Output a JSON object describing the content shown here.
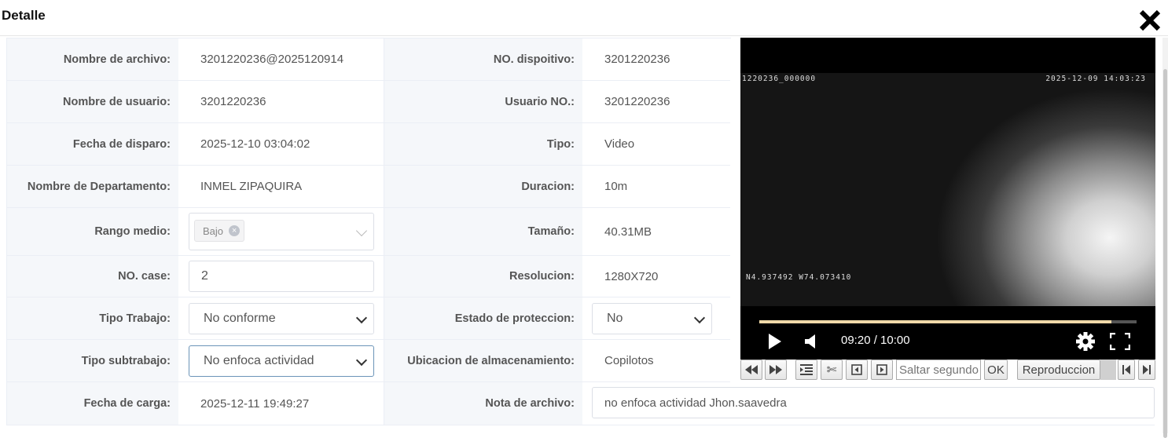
{
  "dialog": {
    "title": "Detalle"
  },
  "fields": {
    "nombre_archivo": {
      "label": "Nombre de archivo:",
      "value": "3201220236@2025120914"
    },
    "no_dispositivo": {
      "label": "NO. dispoitivo:",
      "value": "3201220236"
    },
    "nombre_usuario": {
      "label": "Nombre de usuario:",
      "value": "3201220236"
    },
    "usuario_no": {
      "label": "Usuario NO.:",
      "value": "3201220236"
    },
    "fecha_disparo": {
      "label": "Fecha de disparo:",
      "value": "2025-12-10 03:04:02"
    },
    "tipo": {
      "label": "Tipo:",
      "value": "Video"
    },
    "departamento": {
      "label": "Nombre de Departamento:",
      "value": "INMEL ZIPAQUIRA"
    },
    "duracion": {
      "label": "Duracion:",
      "value": "10m"
    },
    "rango_medio": {
      "label": "Rango medio:",
      "tag": "Bajo"
    },
    "tamano": {
      "label": "Tamaño:",
      "value": "40.31MB"
    },
    "no_case": {
      "label": "NO. case:",
      "value": "2"
    },
    "resolucion": {
      "label": "Resolucion:",
      "value": "1280X720"
    },
    "tipo_trabajo": {
      "label": "Tipo Trabajo:",
      "value": "No conforme"
    },
    "estado_proteccion": {
      "label": "Estado de proteccion:",
      "value": "No"
    },
    "tipo_subtrabajo": {
      "label": "Tipo subtrabajo:",
      "value": "No enfoca actividad"
    },
    "ubicacion": {
      "label": "Ubicacion de almacenamiento:",
      "value": "Copilotos"
    },
    "fecha_carga": {
      "label": "Fecha de carga:",
      "value": "2025-12-11 19:49:27"
    },
    "nota_archivo": {
      "label": "Nota de archivo:",
      "value": "no enfoca actividad Jhon.saavedra"
    }
  },
  "video": {
    "osd_top_left": "1220236_000000",
    "osd_top_right": "2025-12-09 14:03:23",
    "osd_bottom_left": "N4.937492 W74.073410",
    "time": "09:20 / 10:00",
    "progress": 0.933
  },
  "toolbar": {
    "cut_glyph": "✄",
    "seek_placeholder": "Saltar segundo",
    "ok_label": "OK",
    "playback_label": "Reproduccion"
  },
  "icons": [
    "close-icon",
    "play-icon",
    "volume-icon",
    "settings-icon",
    "fullscreen-icon",
    "rewind-icon",
    "fast-forward-icon",
    "list-icon",
    "scissors-icon",
    "prev-frame-icon",
    "next-frame-icon",
    "skip-start-icon",
    "skip-end-icon",
    "chevron-down-icon",
    "tag-remove-icon"
  ]
}
